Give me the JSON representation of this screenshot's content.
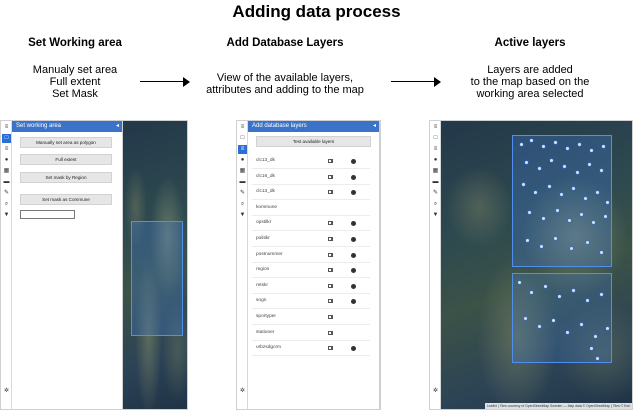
{
  "title": "Adding data process",
  "steps": [
    {
      "title": "Set Working area",
      "lines": [
        "Manualy set area",
        "Full extent",
        "Set Mask"
      ]
    },
    {
      "title": "Add Database Layers",
      "lines": [
        "View of the available layers,",
        "attributes and adding to the map"
      ]
    },
    {
      "title": "Active layers",
      "lines": [
        "Layers are added",
        "to the map based on the",
        "working area selected"
      ]
    }
  ],
  "screens": {
    "working_area": {
      "panel_title": "Set working area",
      "buttons": [
        "Manually set area as polygon",
        "Full extent",
        "Set mask by Region",
        "Set mask as Commune"
      ]
    },
    "database_layers": {
      "panel_title": "Add database layers",
      "test_button": "Test available layers",
      "layers": [
        "clc13_dk",
        "clc16_dk",
        "clc13_dk",
        "kommune",
        "opstilkr",
        "politikr",
        "postnummer",
        "region",
        "retskr",
        "sogn",
        "sportyper",
        "stationer",
        "urbzsdgcrm"
      ],
      "table_icons": [
        true,
        true,
        true,
        false,
        true,
        true,
        true,
        true,
        true,
        true,
        true,
        true,
        true
      ],
      "add_icons": [
        true,
        true,
        true,
        false,
        true,
        true,
        true,
        true,
        true,
        true,
        false,
        false,
        true
      ]
    },
    "active_layers": {
      "attribution": "Leaflet | Tiles courtesy of OpenStreetMap Sweden — Map data © OpenStreetMap | Tiles © Esri"
    }
  },
  "toolbar_icons": [
    "menu-icon",
    "square-icon",
    "layers-icon",
    "globe-icon",
    "grid-icon",
    "folder-icon",
    "edit-icon",
    "search-icon",
    "filter-icon"
  ],
  "colors": {
    "accent": "#3b73c9",
    "aoi_fill": "#4682e6"
  }
}
